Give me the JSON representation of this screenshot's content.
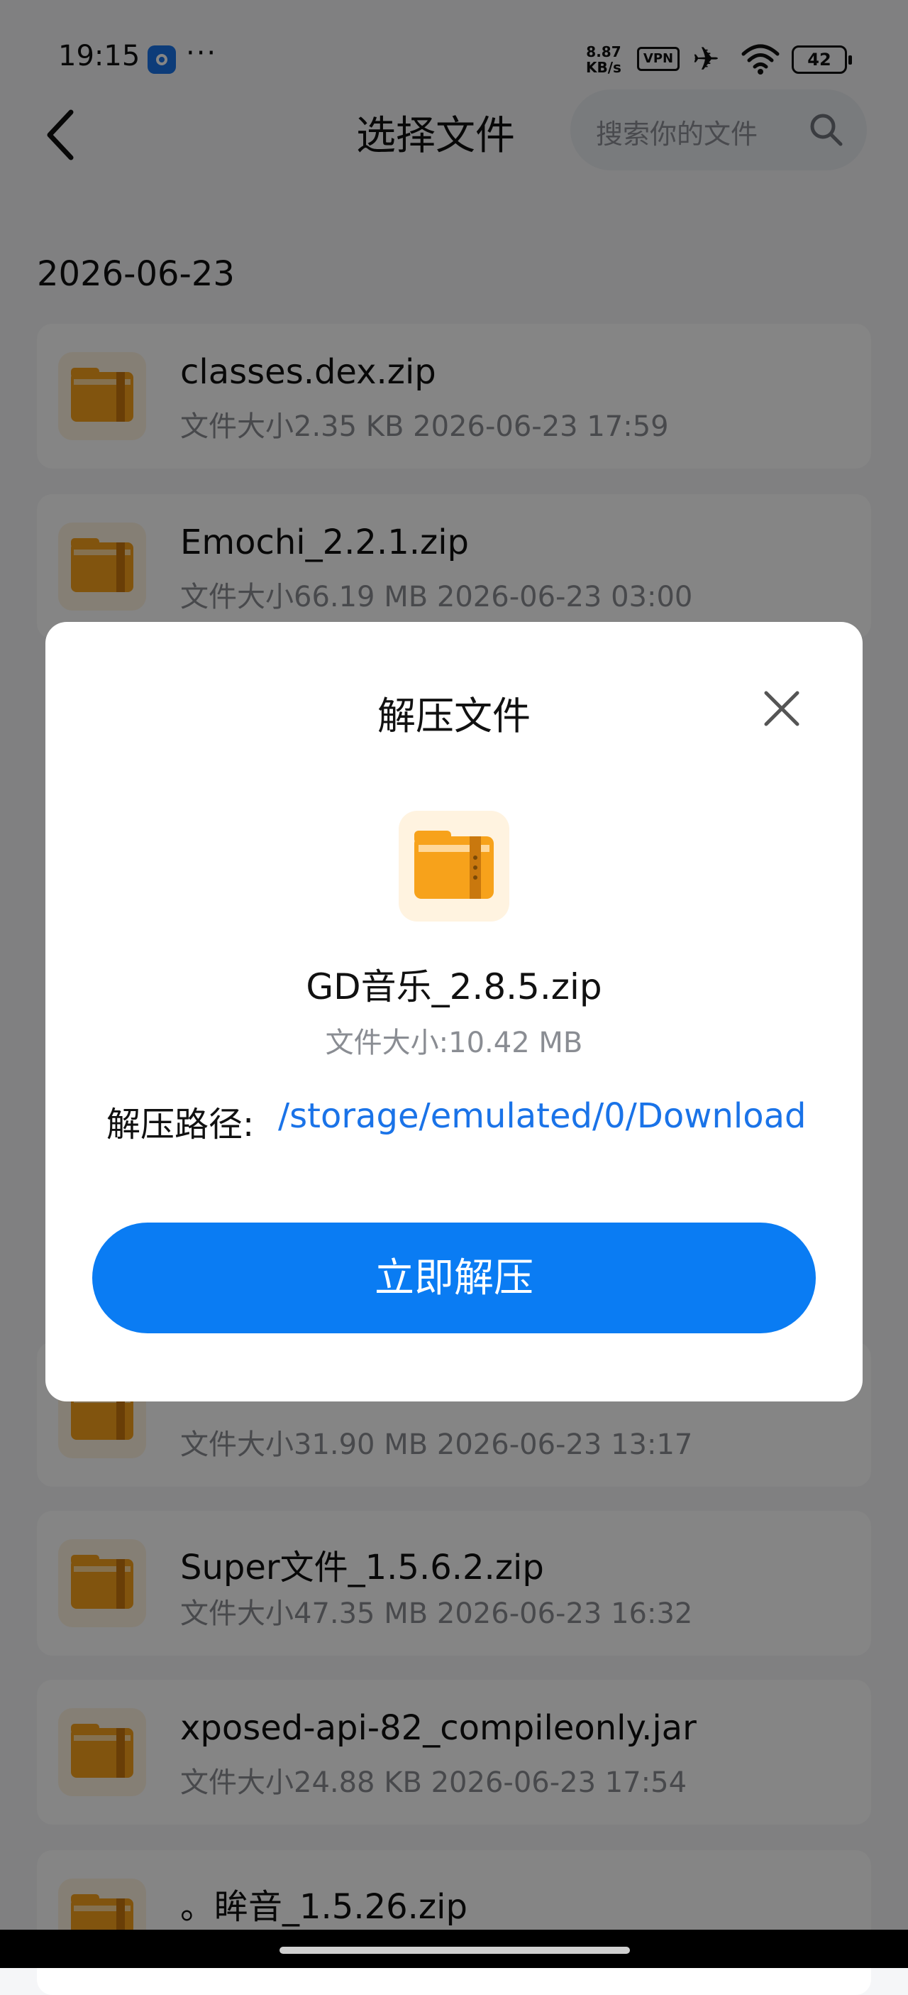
{
  "status_bar": {
    "time": "19:15",
    "more": "···",
    "net_speed_value": "8.87",
    "net_speed_unit": "KB/s",
    "vpn": "VPN",
    "battery": "42"
  },
  "header": {
    "title": "选择文件",
    "search_placeholder": "搜索你的文件"
  },
  "list": {
    "date_group": "2026-06-23",
    "files": [
      {
        "name": "classes.dex.zip",
        "meta": "文件大小2.35 KB 2026-06-23 17:59"
      },
      {
        "name": "Emochi_2.2.1.zip",
        "meta": "文件大小66.19 MB 2026-06-23 03:00"
      },
      {
        "name": "",
        "meta": "文件大小31.90 MB 2026-06-23 13:17"
      },
      {
        "name": "Super文件_1.5.6.2.zip",
        "meta": "文件大小47.35 MB 2026-06-23 16:32"
      },
      {
        "name": "xposed-api-82_compileonly.jar",
        "meta": "文件大小24.88 KB 2026-06-23 17:54"
      },
      {
        "name": "。眸音_1.5.26.zip",
        "meta": ""
      }
    ]
  },
  "dialog": {
    "title": "解压文件",
    "file_name": "GD音乐_2.8.5.zip",
    "file_size": "文件大小:10.42 MB",
    "path_label": "解压路径:",
    "path_value": "/storage/emulated/0/Download",
    "button_label": "立即解压"
  },
  "colors": {
    "accent": "#0a7cf3",
    "path_link": "#1a73e8",
    "zip_icon_bg": "#fff3e0",
    "zip_icon_folder": "#f7a21b"
  },
  "icons": {
    "back": "chevron-left-icon",
    "search": "search-icon",
    "close": "close-icon",
    "file": "zip-folder-icon",
    "airplane": "airplane-icon",
    "wifi": "wifi-icon"
  }
}
